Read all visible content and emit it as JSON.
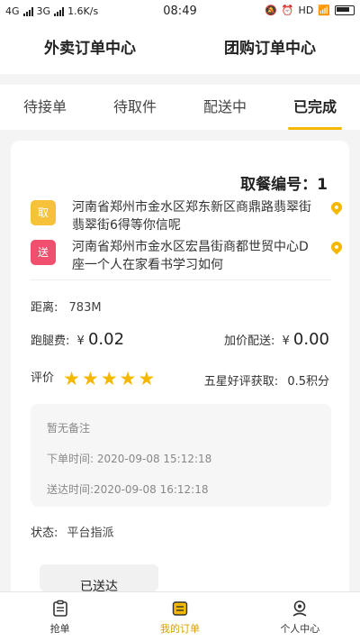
{
  "status_bar": {
    "network1": "4G",
    "network2": "3G",
    "speed": "1.6K/s",
    "time": "08:49",
    "hd": "HD"
  },
  "top_tabs": [
    {
      "label": "外卖订单中心"
    },
    {
      "label": "团购订单中心"
    }
  ],
  "sub_tabs": [
    {
      "label": "待接单"
    },
    {
      "label": "待取件"
    },
    {
      "label": "配送中"
    },
    {
      "label": "已完成"
    }
  ],
  "order": {
    "pickup_number": "取餐编号：1",
    "pickup_badge": "取",
    "pickup_address": "河南省郑州市金水区郑东新区商鼎路翡翠街翡翠街6得等你信呢",
    "send_badge": "送",
    "send_address": "河南省郑州市金水区宏昌街商都世贸中心D座一个人在家看书学习如何",
    "distance_label": "距离:",
    "distance_value": "783M",
    "fee_label": "跑腿费:",
    "fee_currency": "¥",
    "fee_value": "0.02",
    "extra_label": "加价配送:",
    "extra_currency": "¥",
    "extra_value": "0.00",
    "rating_label": "评价",
    "rating_stars": 5,
    "reward_label": "五星好评获取:",
    "reward_value": "0.5积分",
    "note": "暂无备注",
    "order_time": "下单时间: 2020-09-08 15:12:18",
    "delivered_time": "送达时间:2020-09-08 16:12:18",
    "status_label": "状态:",
    "status_value": "平台指派",
    "action_button": "已送达"
  },
  "bottom_nav": [
    {
      "label": "抢单",
      "icon": "grab-order-icon"
    },
    {
      "label": "我的订单",
      "icon": "my-orders-icon"
    },
    {
      "label": "个人中心",
      "icon": "profile-icon"
    }
  ],
  "colors": {
    "accent": "#f5b800",
    "pickup_badge": "#f7c23b",
    "send_badge": "#f0506e"
  }
}
